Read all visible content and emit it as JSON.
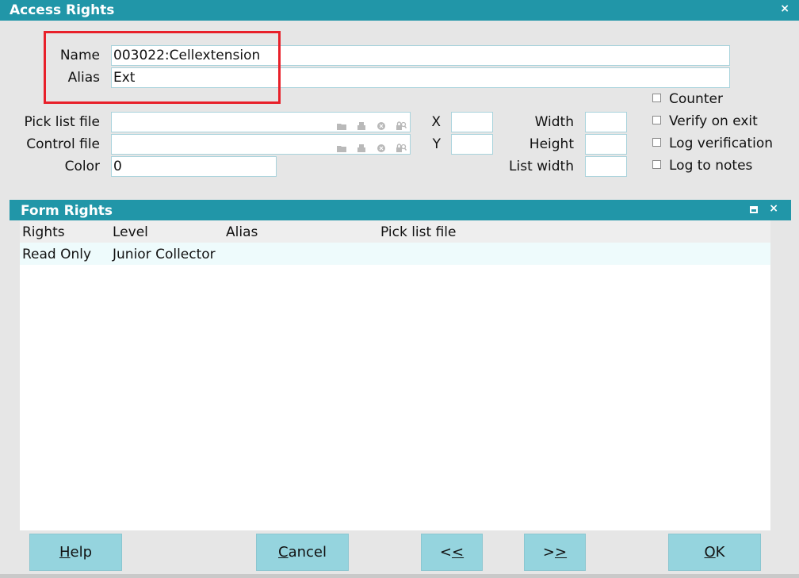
{
  "window": {
    "title": "Access Rights",
    "close_glyph": "×"
  },
  "fields": {
    "name_label": "Name",
    "name_value": "003022:Cellextension",
    "alias_label": "Alias",
    "alias_value": "Ext",
    "pick_list_label": "Pick list file",
    "pick_list_value": "",
    "control_file_label": "Control file",
    "control_file_value": "",
    "color_label": "Color",
    "color_value": "0",
    "x_label": "X",
    "x_value": "",
    "y_label": "Y",
    "y_value": "",
    "width_label": "Width",
    "width_value": "",
    "height_label": "Height",
    "height_value": "",
    "list_width_label": "List width",
    "list_width_value": ""
  },
  "field_icons": [
    "folder-icon",
    "print-icon",
    "clear-icon",
    "lock-search-icon"
  ],
  "checkboxes": [
    {
      "label": "Counter",
      "checked": false
    },
    {
      "label": "Verify on exit",
      "checked": false
    },
    {
      "label": "Log verification",
      "checked": false
    },
    {
      "label": "Log to notes",
      "checked": false
    }
  ],
  "form_rights": {
    "title": "Form Rights",
    "close_glyph": "×",
    "columns": [
      "Rights",
      "Level",
      "Alias",
      "Pick list file"
    ],
    "rows": [
      {
        "rights": "Read Only",
        "level": "Junior Collector",
        "alias": "",
        "pick_list_file": ""
      }
    ]
  },
  "buttons": {
    "help": {
      "mnemonic": "H",
      "rest": "elp"
    },
    "cancel": {
      "mnemonic": "C",
      "rest": "ancel"
    },
    "prev": {
      "pre": "<",
      "mnemonic": "<"
    },
    "next": {
      "pre": ">",
      "mnemonic": ">"
    },
    "ok": {
      "mnemonic": "O",
      "rest": "K"
    }
  },
  "colors": {
    "accent": "#2196a8",
    "button": "#95d4de",
    "highlight_box": "#e8202a"
  }
}
